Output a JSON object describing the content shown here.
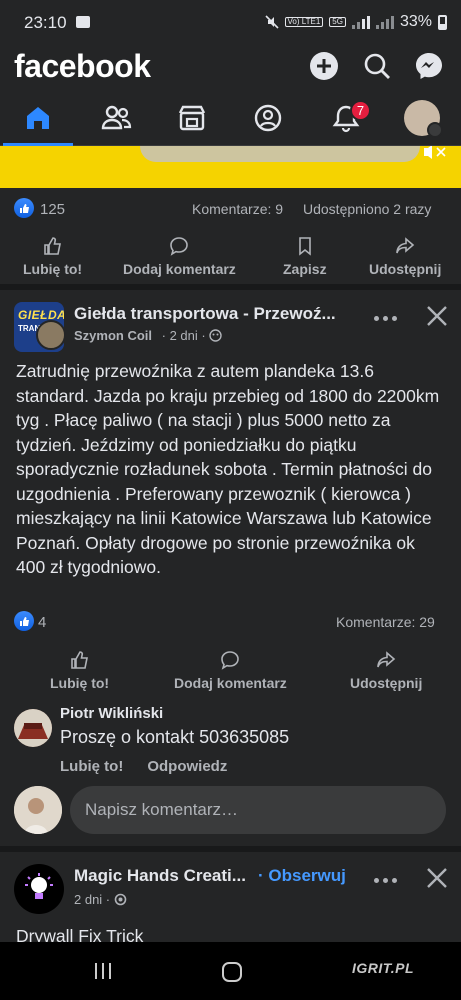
{
  "status_bar": {
    "time": "23:10",
    "network": "Vo) LTE1",
    "network_type": "5G",
    "battery": "33%"
  },
  "header": {
    "logo": "facebook",
    "create_icon": "plus-icon",
    "search_icon": "search-icon",
    "messenger_icon": "messenger-icon"
  },
  "nav": {
    "active": "home",
    "notifications_badge": "7",
    "items": [
      "home",
      "friends",
      "marketplace",
      "profile",
      "notifications",
      "menu"
    ]
  },
  "post1": {
    "reactions_count": "125",
    "comments": "Komentarze: 9",
    "shares": "Udostępniono 2 razy",
    "actions": {
      "like": "Lubię to!",
      "comment": "Dodaj komentarz",
      "save": "Zapisz",
      "share": "Udostępnij"
    }
  },
  "post2": {
    "group": "Giełda transportowa - Przewoź...",
    "group_avatar_text": "GIEŁDA",
    "group_avatar_sub": "TRANSP",
    "author": "Szymon Coil",
    "time": "· 2 dni ·",
    "text": "Zatrudnię przewoźnika z autem plandeka 13.6 standard.  Jazda po kraju przebieg od 1800 do 2200km tyg . Płacę paliwo ( na stacji ) plus 5000 netto za tydzień.  Jeździmy od poniedziałku do piątku sporadycznie rozładunek sobota . Termin płatności do uzgodnienia . Preferowany przewoznik ( kierowca ) mieszkający na linii Katowice Warszawa lub Katowice Poznań. Opłaty drogowe po stronie przewoźnika ok 400 zł tygodniowo.",
    "reactions_count": "4",
    "comments": "Komentarze: 29",
    "actions": {
      "like": "Lubię to!",
      "comment": "Dodaj komentarz",
      "share": "Udostępnij"
    },
    "comment": {
      "name": "Piotr Wikliński",
      "text": "Proszę  o kontakt 503635085",
      "like": "Lubię to!",
      "reply": "Odpowiedz"
    },
    "composer_placeholder": "Napisz komentarz…"
  },
  "post3": {
    "page": "Magic Hands Creati...",
    "follow": "· Obserwuj",
    "time": "2 dni ·",
    "text": "Drywall Fix Trick"
  },
  "watermark": "IGRIT.PL",
  "colors": {
    "accent": "#2d88ff",
    "badge": "#e41e3f",
    "background": "#242526",
    "ad": "#f5d300"
  }
}
